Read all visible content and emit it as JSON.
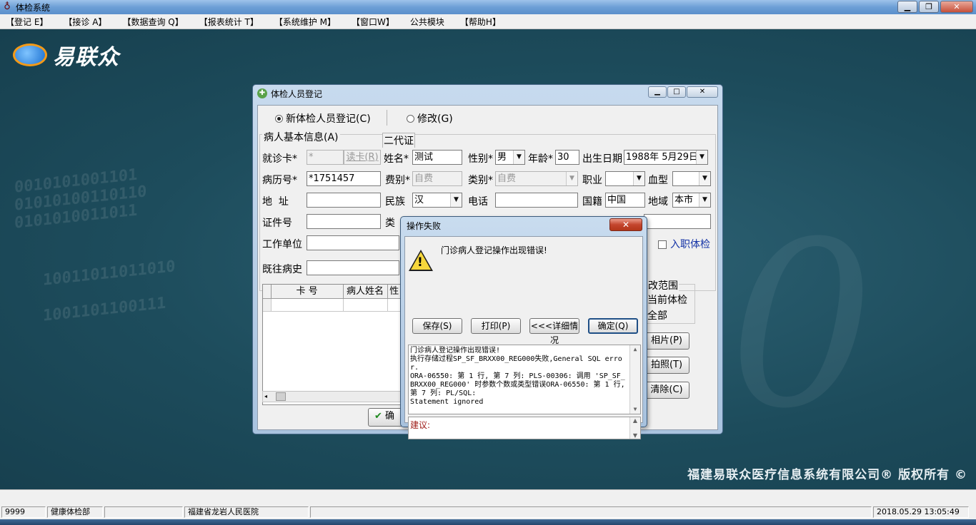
{
  "app": {
    "title": "体检系统",
    "icon": "app-logo-icon"
  },
  "menu": [
    "【登记 E】",
    "【接诊 A】",
    "【数据查询 Q】",
    "【报表统计 T】",
    "【系统维护 M】",
    "【窗口W】",
    "公共模块",
    "【帮助H】"
  ],
  "brand": {
    "logo_text": "易联众",
    "copyright": "福建易联众医疗信息系统有限公司® 版权所有 ©"
  },
  "registration": {
    "title": "体检人员登记",
    "mode_new": "新体检人员登记(C)",
    "mode_edit": "修改(G)",
    "group_basic": "病人基本信息(A)",
    "id_card_tab": "二代证",
    "card_label": "就诊卡*",
    "card_value": "*",
    "read_card_button": "读卡(R)",
    "name_label": "姓名*",
    "name_value": "测试",
    "gender_label": "性别*",
    "gender_value": "男",
    "age_label": "年龄*",
    "age_value": "30",
    "birth_label": "出生日期",
    "birth_value": "1988年 5月29日",
    "record_label": "病历号*",
    "record_value": "*1751457",
    "fee_label": "费别*",
    "fee_value": "自费",
    "category_label": "类别*",
    "category_value": "自费",
    "job_label": "职业",
    "job_value": "",
    "blood_label": "血型",
    "blood_value": "",
    "address_label": "地  址",
    "address_value": "",
    "ethnic_label": "民族",
    "ethnic_value": "汉",
    "phone_label": "电话",
    "phone_value": "",
    "country_label": "国籍",
    "country_value": "中国",
    "region_label": "地域",
    "region_value": "本市",
    "idno_label": "证件号",
    "idno_value": "",
    "type_label": "类",
    "employer_label": "工作单位",
    "employer_value": "",
    "preemployment_label": "入职体检",
    "history_label": "既往病史",
    "history_value": "",
    "grid_headers": [
      "卡  号",
      "病人姓名",
      "性"
    ],
    "scope_group": "改范围",
    "scope_current": "当前体检",
    "scope_all": "全部",
    "photo_button": "相片(P)",
    "capture_button": "拍照(T)",
    "clear_button": "清除(C)",
    "confirm_button": "确"
  },
  "error_dialog": {
    "title": "操作失败",
    "message": "门诊病人登记操作出现错误!",
    "save_button": "保存(S)",
    "print_button": "打印(P)",
    "detail_button": "<<<详细情况",
    "ok_button": "确定(Q)",
    "detail_text": "门诊病人登记操作出现错误!\n执行存储过程SP_SF_BRXX00_REG000失败,General SQL error.\nORA-06550: 第 1 行, 第 7 列: PLS-00306: 调用 'SP_SF_BRXX00_REG000' 时参数个数或类型错误ORA-06550: 第 1 行, 第 7 列: PL/SQL:\nStatement ignored",
    "suggestion_label": "建议:"
  },
  "status": {
    "code": "9999",
    "dept": "健康体检部",
    "blank1": "",
    "hospital": "福建省龙岩人民医院",
    "blank2": "",
    "datetime": "2018.05.29 13:05:49"
  }
}
